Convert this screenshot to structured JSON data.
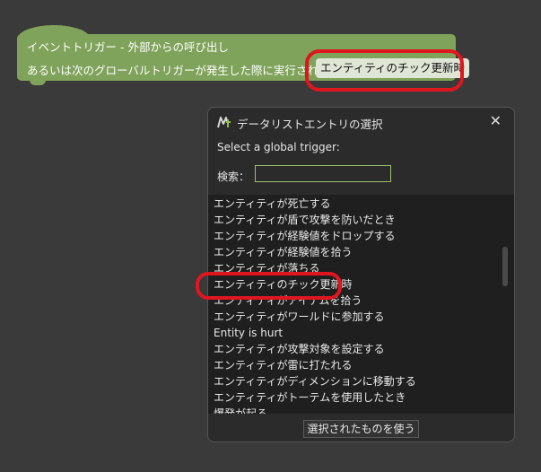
{
  "block": {
    "line1": "イベントトリガー - 外部からの呼び出し",
    "line2": "あるいは次のグローバルトリガーが発生した際に実行される：",
    "field_value": "エンティティのチック更新時",
    "color": "#7fa35a"
  },
  "dialog": {
    "title": "データリストエントリの選択",
    "icon": "mcreator-logo-icon",
    "close": "✕",
    "subtitle": "Select a global trigger:",
    "search_label": "検索：",
    "search_value": "",
    "items": [
      "エンティティが死亡する",
      "エンティティが盾で攻撃を防いだとき",
      "エンティティが経験値をドロップする",
      "エンティティが経験値を拾う",
      "エンティティが落ちる",
      "エンティティのチック更新時",
      "エンティティがアイテムを拾う",
      "エンティティがワールドに参加する",
      "Entity is hurt",
      "エンティティが攻撃対象を設定する",
      "エンティティが雷に打たれる",
      "エンティティがディメンションに移動する",
      "エンティティがトーテムを使用したとき",
      "爆発が起る"
    ],
    "use_button": "選択されたものを使う"
  },
  "highlight_color": "#e0161f"
}
